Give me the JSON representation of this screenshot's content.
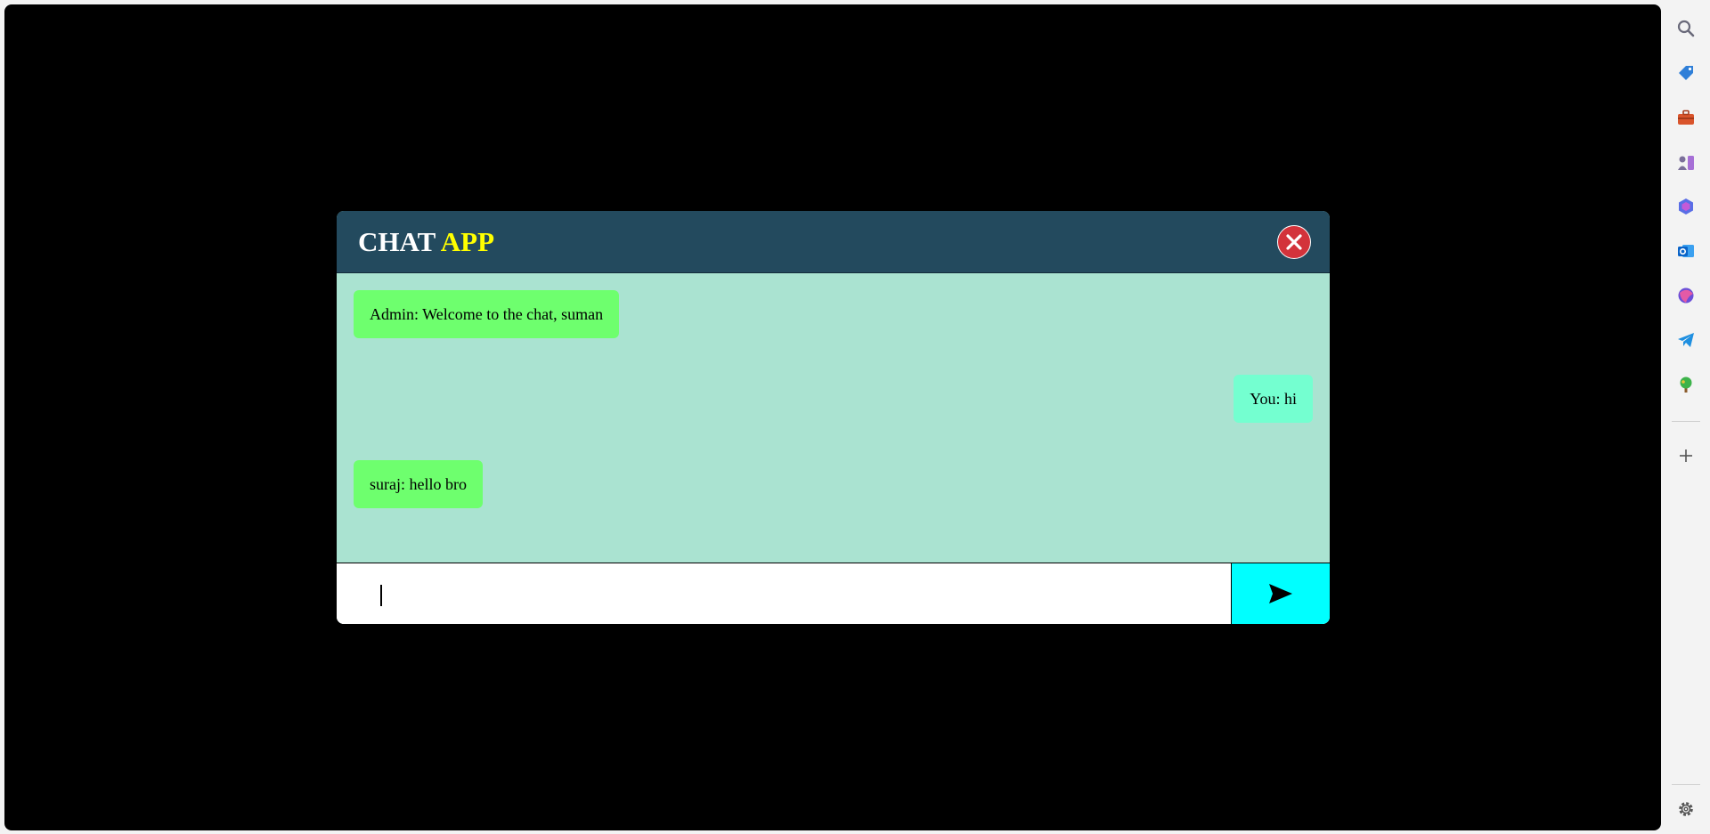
{
  "chat": {
    "title_main": "CHAT",
    "title_accent": "APP",
    "messages": [
      {
        "text": "Admin: Welcome to the chat, suman",
        "side": "incoming"
      },
      {
        "text": "You: hi",
        "side": "outgoing"
      },
      {
        "text": "suraj: hello bro",
        "side": "incoming"
      }
    ],
    "input": {
      "value": "",
      "placeholder": ""
    },
    "close_icon": "close-icon",
    "send_icon": "send-icon"
  },
  "sidebar": {
    "icons": [
      "search-icon",
      "tag-icon",
      "toolbox-icon",
      "games-icon",
      "copilot-icon",
      "outlook-icon",
      "designer-icon",
      "telegram-icon",
      "tree-icon",
      "add-icon",
      "settings-icon"
    ]
  },
  "colors": {
    "page_background": "#000000",
    "header": "#234a5e",
    "title_accent": "#ffff00",
    "messages_background": "#aae3d1",
    "incoming_bubble": "#6eff6e",
    "outgoing_bubble": "#74ffd0",
    "close_button": "#d3333b",
    "send_button": "#00ffff"
  }
}
